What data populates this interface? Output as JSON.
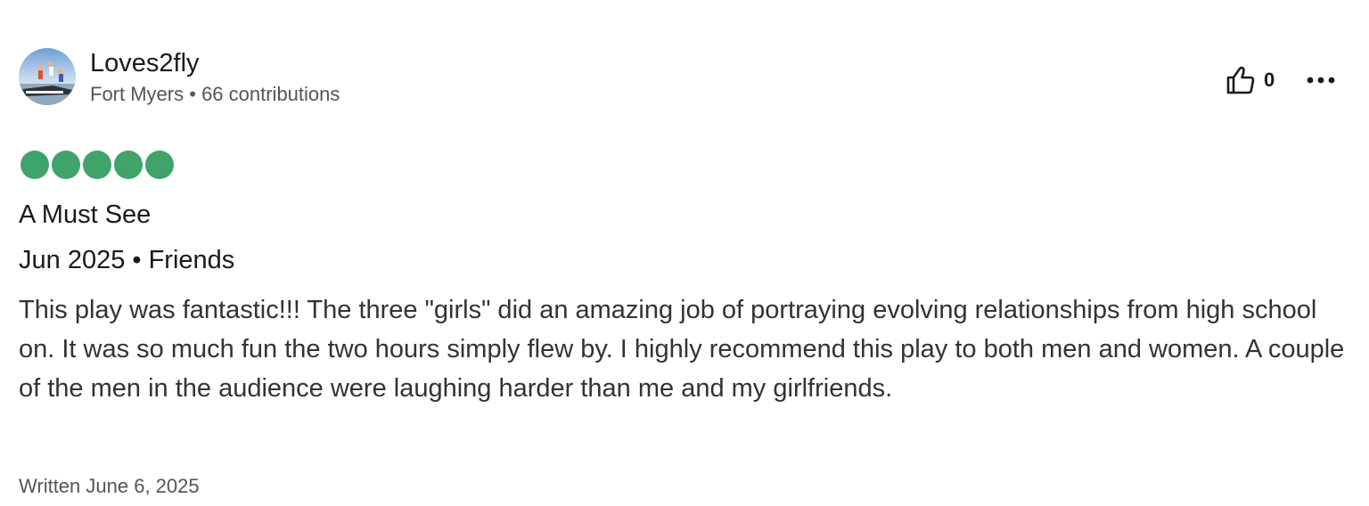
{
  "reviewer": {
    "name": "Loves2fly",
    "location": "Fort Myers",
    "separator": " • ",
    "contributions": "66 contributions"
  },
  "actions": {
    "helpful_icon": "thumbs-up-icon",
    "helpful_count": "0",
    "more_icon": "ellipsis-icon"
  },
  "rating": {
    "value": 5,
    "max": 5,
    "bubble_color": "#3fa36a"
  },
  "review": {
    "title": "A Must See",
    "trip_info": "Jun 2025 • Friends",
    "body": "This play was fantastic!!! The three \"girls\" did an amazing job of portraying evolving relationships from high school on. It was so much fun the two hours simply flew by. I highly recommend this play to both men and women. A couple of the men in the audience were laughing harder than me and my girlfriends.",
    "written": "Written June 6, 2025"
  }
}
